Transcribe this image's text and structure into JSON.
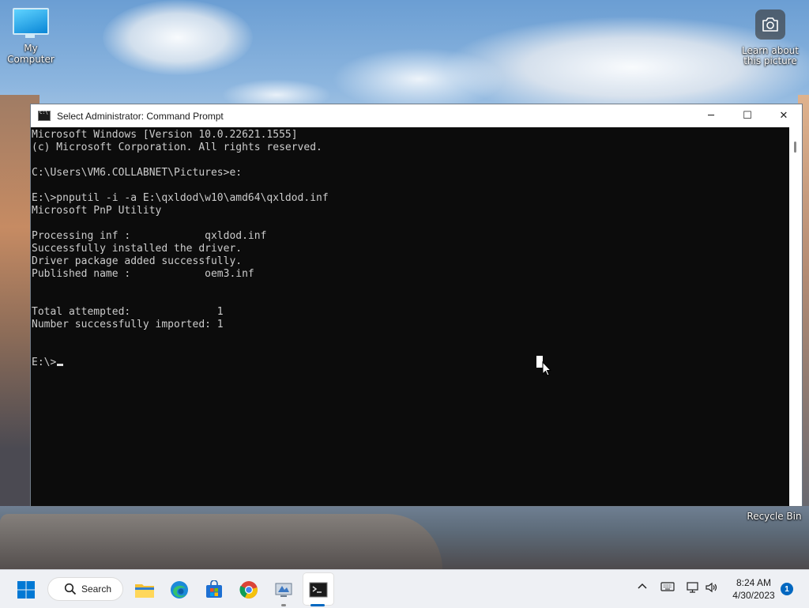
{
  "desktop": {
    "icons": [
      {
        "label": "My Computer"
      },
      {
        "label": "Learn about this picture"
      },
      {
        "label": "Recycle Bin"
      }
    ]
  },
  "window": {
    "title": "Select Administrator: Command Prompt",
    "controls": {
      "minimize": "─",
      "maximize": "☐",
      "close": "✕"
    },
    "console_text": "Microsoft Windows [Version 10.0.22621.1555]\n(c) Microsoft Corporation. All rights reserved.\n\nC:\\Users\\VM6.COLLABNET\\Pictures>e:\n\nE:\\>pnputil -i -a E:\\qxldod\\w10\\amd64\\qxldod.inf\nMicrosoft PnP Utility\n\nProcessing inf :            qxldod.inf\nSuccessfully installed the driver.\nDriver package added successfully.\nPublished name :            oem3.inf\n\n\nTotal attempted:              1\nNumber successfully imported: 1\n\n\nE:\\>"
  },
  "taskbar": {
    "search_label": "Search",
    "clock": {
      "time": "8:24 AM",
      "date": "4/30/2023"
    },
    "notification_count": "1",
    "apps": [
      {
        "icon": "windows-start-icon"
      },
      {
        "icon": "file-explorer-icon"
      },
      {
        "icon": "edge-icon"
      },
      {
        "icon": "microsoft-store-icon"
      },
      {
        "icon": "chrome-icon"
      },
      {
        "icon": "app-icon"
      },
      {
        "icon": "command-prompt-icon",
        "active": true
      }
    ],
    "tray_icons": [
      "chevron-up-icon",
      "keyboard-icon",
      "network-icon",
      "volume-icon"
    ]
  },
  "colors": {
    "console_bg": "#0c0c0c",
    "console_fg": "#cccccc",
    "accent": "#0067c0",
    "taskbar_bg": "#eef0f4"
  }
}
